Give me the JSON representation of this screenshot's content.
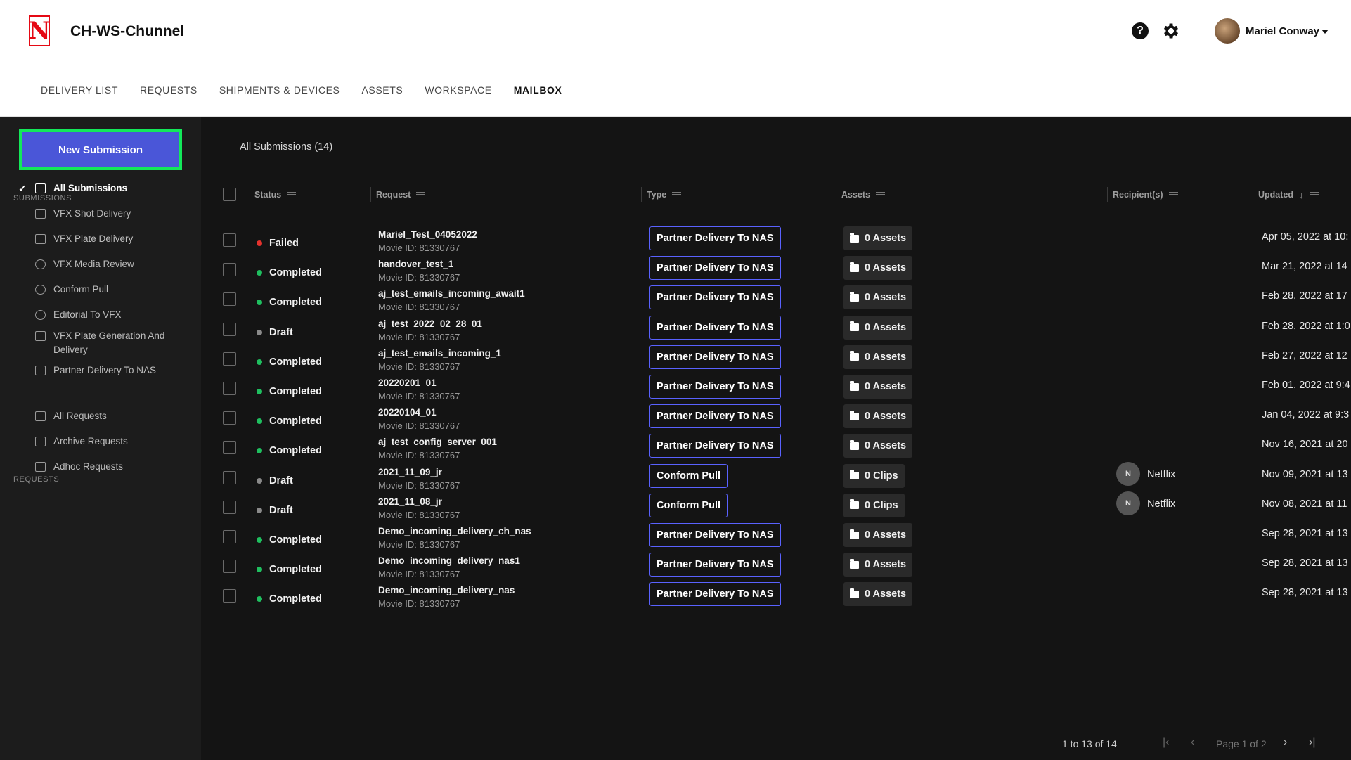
{
  "header": {
    "app_title": "CH-WS-Chunnel",
    "logo_letter": "N",
    "user_name": "Mariel Conway",
    "help_symbol": "?",
    "icons": [
      "netflix-logo-icon",
      "help-icon",
      "gear-icon",
      "avatar",
      "chevron-down-icon"
    ]
  },
  "nav": {
    "items": [
      {
        "label": "DELIVERY LIST"
      },
      {
        "label": "REQUESTS"
      },
      {
        "label": "SHIPMENTS & DEVICES"
      },
      {
        "label": "ASSETS"
      },
      {
        "label": "WORKSPACE"
      },
      {
        "label": "MAILBOX"
      }
    ],
    "active": "MAILBOX"
  },
  "sidebar": {
    "new_submission_label": "New Submission",
    "submissions_label": "SUBMISSIONS",
    "requests_label": "REQUESTS",
    "check_mark": "✓",
    "submissions": [
      {
        "label": "All Submissions",
        "icon": "folder-icon",
        "active": true
      },
      {
        "label": "VFX Shot Delivery",
        "icon": "image-icon"
      },
      {
        "label": "VFX Plate Delivery",
        "icon": "layers-icon"
      },
      {
        "label": "VFX Media Review",
        "icon": "review-icon"
      },
      {
        "label": "Conform Pull",
        "icon": "film-reel-icon"
      },
      {
        "label": "Editorial To VFX",
        "icon": "film-reel-icon"
      },
      {
        "label": "VFX Plate Generation And Delivery",
        "icon": "layers-icon"
      },
      {
        "label": "Partner Delivery To NAS",
        "icon": "transfer-icon"
      }
    ],
    "requests": [
      {
        "label": "All Requests",
        "icon": "list-icon"
      },
      {
        "label": "Archive Requests",
        "icon": "archive-icon"
      },
      {
        "label": "Adhoc Requests",
        "icon": "user-add-icon"
      }
    ]
  },
  "main": {
    "title": "All Submissions (14)",
    "columns": {
      "status": "Status",
      "request": "Request",
      "type": "Type",
      "assets": "Assets",
      "recipients": "Recipient(s)",
      "updated": "Updated"
    },
    "rows": [
      {
        "status": "Failed",
        "status_color": "#e5322d",
        "name": "Mariel_Test_04052022",
        "movie_id": "Movie ID: 81330767",
        "type": "Partner Delivery To NAS",
        "assets": "0 Assets",
        "recipient": "",
        "recipient_initial": "",
        "updated": "Apr 05, 2022 at 10:"
      },
      {
        "status": "Completed",
        "status_color": "#1fbf5f",
        "name": "handover_test_1",
        "movie_id": "Movie ID: 81330767",
        "type": "Partner Delivery To NAS",
        "assets": "0 Assets",
        "recipient": "",
        "recipient_initial": "",
        "updated": "Mar 21, 2022 at 14"
      },
      {
        "status": "Completed",
        "status_color": "#1fbf5f",
        "name": "aj_test_emails_incoming_await1",
        "movie_id": "Movie ID: 81330767",
        "type": "Partner Delivery To NAS",
        "assets": "0 Assets",
        "recipient": "",
        "recipient_initial": "",
        "updated": "Feb 28, 2022 at 17"
      },
      {
        "status": "Draft",
        "status_color": "#8a8a8a",
        "name": "aj_test_2022_02_28_01",
        "movie_id": "Movie ID: 81330767",
        "type": "Partner Delivery To NAS",
        "assets": "0 Assets",
        "recipient": "",
        "recipient_initial": "",
        "updated": "Feb 28, 2022 at 1:0"
      },
      {
        "status": "Completed",
        "status_color": "#1fbf5f",
        "name": "aj_test_emails_incoming_1",
        "movie_id": "Movie ID: 81330767",
        "type": "Partner Delivery To NAS",
        "assets": "0 Assets",
        "recipient": "",
        "recipient_initial": "",
        "updated": "Feb 27, 2022 at 12"
      },
      {
        "status": "Completed",
        "status_color": "#1fbf5f",
        "name": "20220201_01",
        "movie_id": "Movie ID: 81330767",
        "type": "Partner Delivery To NAS",
        "assets": "0 Assets",
        "recipient": "",
        "recipient_initial": "",
        "updated": "Feb 01, 2022 at 9:4"
      },
      {
        "status": "Completed",
        "status_color": "#1fbf5f",
        "name": "20220104_01",
        "movie_id": "Movie ID: 81330767",
        "type": "Partner Delivery To NAS",
        "assets": "0 Assets",
        "recipient": "",
        "recipient_initial": "",
        "updated": "Jan 04, 2022 at 9:3"
      },
      {
        "status": "Completed",
        "status_color": "#1fbf5f",
        "name": "aj_test_config_server_001",
        "movie_id": "Movie ID: 81330767",
        "type": "Partner Delivery To NAS",
        "assets": "0 Assets",
        "recipient": "",
        "recipient_initial": "",
        "updated": "Nov 16, 2021 at 20"
      },
      {
        "status": "Draft",
        "status_color": "#8a8a8a",
        "name": "2021_11_09_jr",
        "movie_id": "Movie ID: 81330767",
        "type": "Conform Pull",
        "assets": "0 Clips",
        "recipient": "Netflix",
        "recipient_initial": "N",
        "updated": "Nov 09, 2021 at 13"
      },
      {
        "status": "Draft",
        "status_color": "#8a8a8a",
        "name": "2021_11_08_jr",
        "movie_id": "Movie ID: 81330767",
        "type": "Conform Pull",
        "assets": "0 Clips",
        "recipient": "Netflix",
        "recipient_initial": "N",
        "updated": "Nov 08, 2021 at 11"
      },
      {
        "status": "Completed",
        "status_color": "#1fbf5f",
        "name": "Demo_incoming_delivery_ch_nas",
        "movie_id": "Movie ID: 81330767",
        "type": "Partner Delivery To NAS",
        "assets": "0 Assets",
        "recipient": "",
        "recipient_initial": "",
        "updated": "Sep 28, 2021 at 13"
      },
      {
        "status": "Completed",
        "status_color": "#1fbf5f",
        "name": "Demo_incoming_delivery_nas1",
        "movie_id": "Movie ID: 81330767",
        "type": "Partner Delivery To NAS",
        "assets": "0 Assets",
        "recipient": "",
        "recipient_initial": "",
        "updated": "Sep 28, 2021 at 13"
      },
      {
        "status": "Completed",
        "status_color": "#1fbf5f",
        "name": "Demo_incoming_delivery_nas",
        "movie_id": "Movie ID: 81330767",
        "type": "Partner Delivery To NAS",
        "assets": "0 Assets",
        "recipient": "",
        "recipient_initial": "",
        "updated": "Sep 28, 2021 at 13"
      }
    ],
    "pagination": {
      "range": "1 to 13 of 14",
      "page": "Page 1 of 2",
      "first": "|‹",
      "prev": "‹",
      "next": "›",
      "last": "›|"
    }
  },
  "colors": {
    "accent": "#4a56d8",
    "highlight_border": "#13e85a",
    "type_border": "#5a62ff",
    "brand": "#e50914"
  }
}
